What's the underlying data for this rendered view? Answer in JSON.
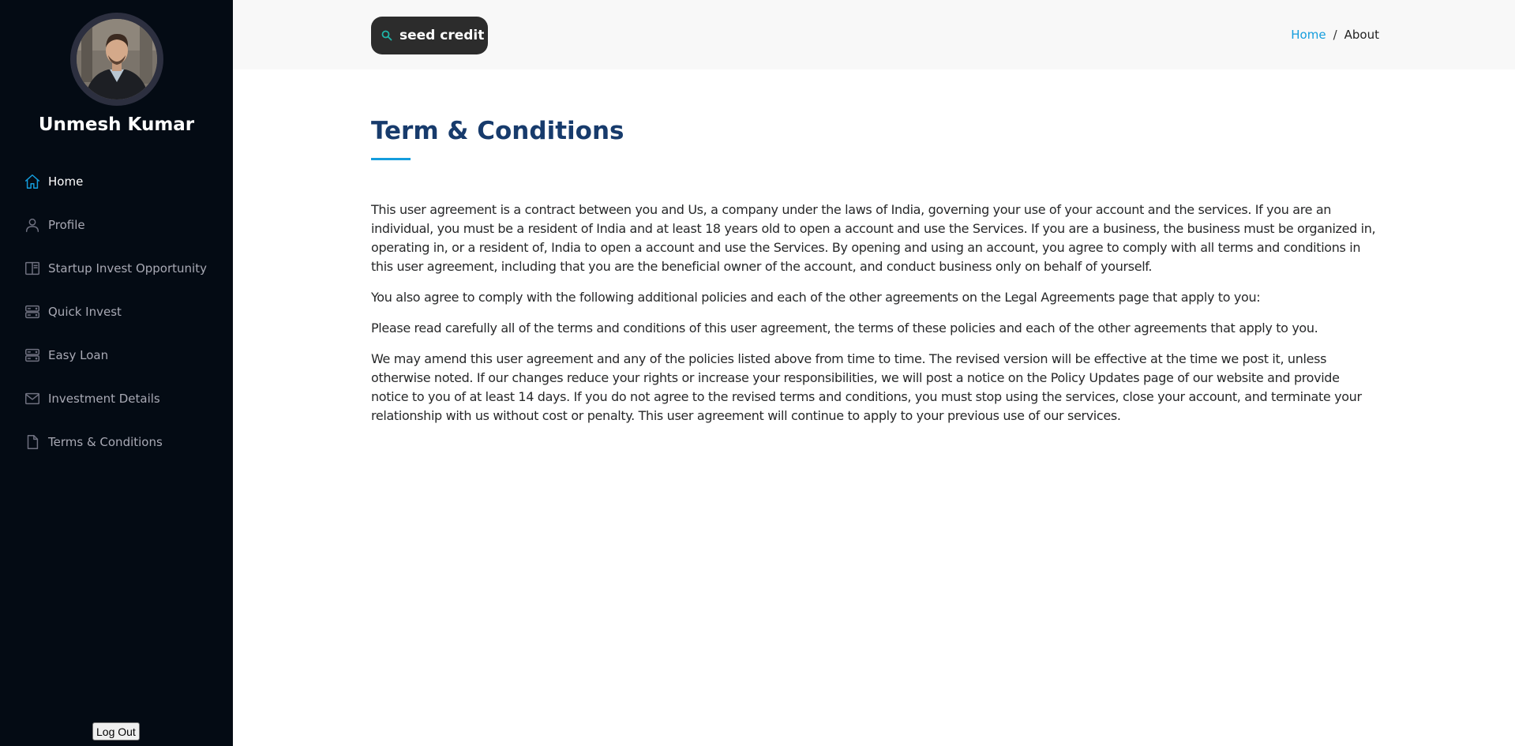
{
  "sidebar": {
    "profile_name": "Unmesh Kumar",
    "items": [
      {
        "label": "Home",
        "icon": "home-icon",
        "active": true
      },
      {
        "label": "Profile",
        "icon": "person-icon",
        "active": false
      },
      {
        "label": "Startup Invest Opportunity",
        "icon": "book-icon",
        "active": false
      },
      {
        "label": "Quick Invest",
        "icon": "server-icon",
        "active": false
      },
      {
        "label": "Easy Loan",
        "icon": "server-icon",
        "active": false
      },
      {
        "label": "Investment Details",
        "icon": "envelope-icon",
        "active": false
      },
      {
        "label": "Terms & Conditions",
        "icon": "file-icon",
        "active": false
      }
    ],
    "logout_label": "Log Out"
  },
  "header": {
    "brand": "seed credit",
    "breadcrumb": {
      "home": "Home",
      "separator": "/",
      "current": "About"
    }
  },
  "main": {
    "title": "Term & Conditions",
    "paragraphs": [
      "This user agreement is a contract between you and Us, a company under the laws of India, governing your use of your account and the services. If you are an individual, you must be a resident of India and at least 18 years old to open a account and use the Services. If you are a business, the business must be organized in, operating in, or a resident of, India to open a account and use the Services. By opening and using an account, you agree to comply with all terms and conditions in this user agreement, including that you are the beneficial owner of the account, and conduct business only on behalf of yourself.",
      "You also agree to comply with the following additional policies and each of the other agreements on the Legal Agreements page that apply to you:",
      "Please read carefully all of the terms and conditions of this user agreement, the terms of these policies and each of the other agreements that apply to you.",
      "We may amend this user agreement and any of the policies listed above from time to time. The revised version will be effective at the time we post it, unless otherwise noted. If our changes reduce your rights or increase your responsibilities, we will post a notice on the Policy Updates page of our website and provide notice to you of at least 14 days. If you do not agree to the revised terms and conditions, you must stop using the services, close your account, and terminate your relationship with us without cost or penalty. This user agreement will continue to apply to your previous use of our services."
    ]
  },
  "colors": {
    "sidebar_bg": "#040b14",
    "accent": "#149ddd",
    "title": "#173b6c",
    "header_bg": "#f8f8f8",
    "brand_bg": "#2c2c2c"
  }
}
